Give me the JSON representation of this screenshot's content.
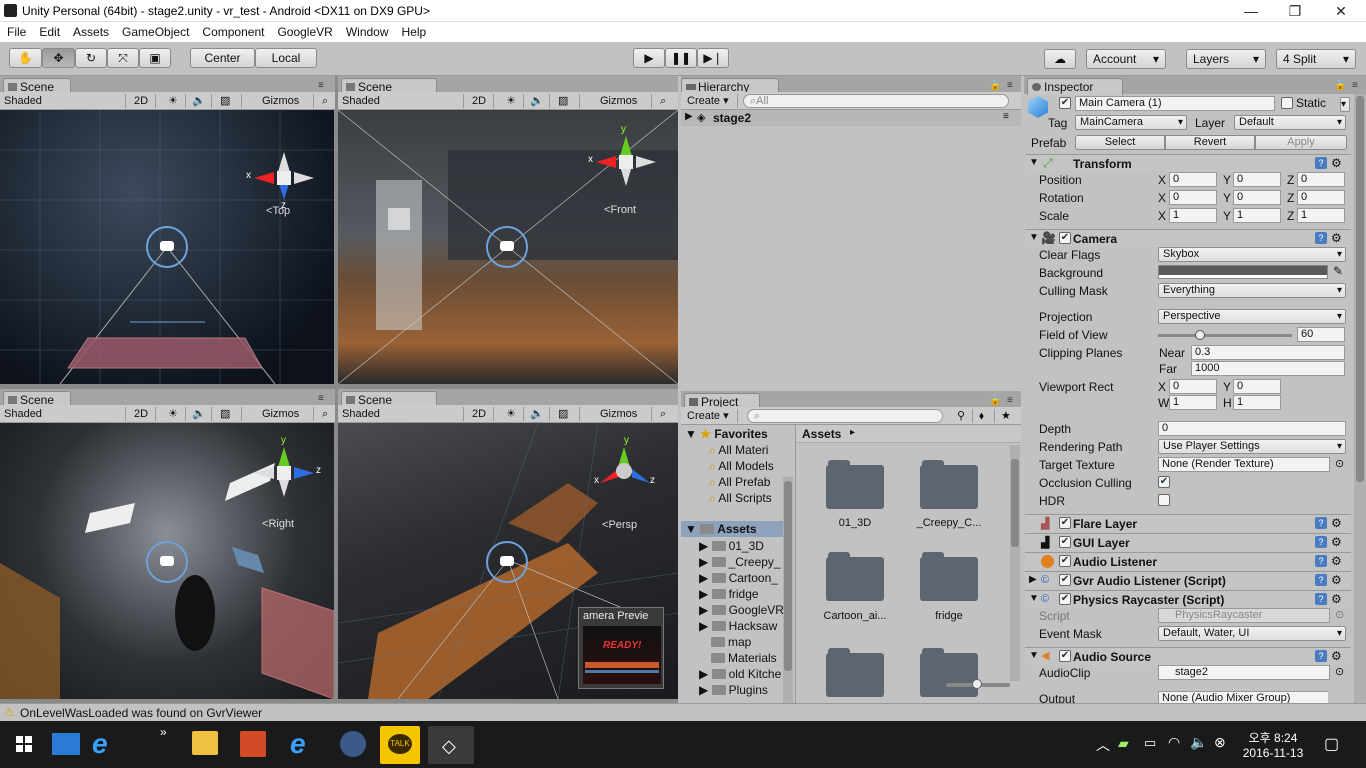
{
  "window": {
    "title": "Unity Personal (64bit) - stage2.unity - vr_test - Android <DX11 on DX9 GPU>",
    "minimize": "—",
    "maximize": "❐",
    "close": "✕"
  },
  "menu": [
    "File",
    "Edit",
    "Assets",
    "GameObject",
    "Component",
    "GoogleVR",
    "Window",
    "Help"
  ],
  "toolbar": {
    "center": "Center",
    "local": "Local",
    "account": "Account",
    "layers": "Layers",
    "layout": "4 Split"
  },
  "scene_views": [
    {
      "tab": "Scene",
      "shading": "Shaded",
      "mode2d": "2D",
      "gizmos": "Gizmos",
      "orient": "Top"
    },
    {
      "tab": "Scene",
      "shading": "Shaded",
      "mode2d": "2D",
      "gizmos": "Gizmos",
      "orient": "Front"
    },
    {
      "tab": "Scene",
      "shading": "Shaded",
      "mode2d": "2D",
      "gizmos": "Gizmos",
      "orient": "Right"
    },
    {
      "tab": "Scene",
      "shading": "Shaded",
      "mode2d": "2D",
      "gizmos": "Gizmos",
      "orient": "Persp",
      "preview": "amera Previe",
      "preview_text": "READY!"
    }
  ],
  "hierarchy": {
    "tab": "Hierarchy",
    "create": "Create",
    "search": "All",
    "root": "stage2"
  },
  "project": {
    "tab": "Project",
    "create": "Create",
    "favorites_label": "Favorites",
    "favorites": [
      "All Materi",
      "All Models",
      "All Prefab",
      "All Scripts"
    ],
    "assets_label": "Assets",
    "folders": [
      "01_3D",
      "_Creepy_",
      "Cartoon_",
      "fridge",
      "GoogleVR",
      "Hacksaw",
      "map",
      "Materials",
      "old Kitche",
      "Plugins"
    ],
    "breadcrumb": "Assets",
    "grid": [
      "01_3D",
      "_Creepy_C...",
      "Cartoon_ai...",
      "fridge"
    ]
  },
  "inspector": {
    "tab": "Inspector",
    "object_name": "Main Camera (1)",
    "static": "Static",
    "tag_label": "Tag",
    "tag": "MainCamera",
    "layer_label": "Layer",
    "layer": "Default",
    "prefab_label": "Prefab",
    "select": "Select",
    "revert": "Revert",
    "apply": "Apply",
    "transform": {
      "title": "Transform",
      "position": "Position",
      "rotation": "Rotation",
      "scale": "Scale",
      "pos": [
        "0",
        "0",
        "0"
      ],
      "rot": [
        "0",
        "0",
        "0"
      ],
      "scl": [
        "1",
        "1",
        "1"
      ]
    },
    "camera": {
      "title": "Camera",
      "clear_flags_label": "Clear Flags",
      "clear_flags": "Skybox",
      "background": "Background",
      "culling_label": "Culling Mask",
      "culling": "Everything",
      "projection_label": "Projection",
      "projection": "Perspective",
      "fov_label": "Field of View",
      "fov": "60",
      "clip_label": "Clipping Planes",
      "near_label": "Near",
      "near": "0.3",
      "far_label": "Far",
      "far": "1000",
      "viewport_label": "Viewport Rect",
      "vx": "0",
      "vy": "0",
      "vw": "1",
      "vh": "1",
      "depth_label": "Depth",
      "depth": "0",
      "render_label": "Rendering Path",
      "render": "Use Player Settings",
      "target_label": "Target Texture",
      "target": "None (Render Texture)",
      "occlusion": "Occlusion Culling",
      "hdr": "HDR",
      "fov_fraction": 0.3
    },
    "components": [
      "Flare Layer",
      "GUI Layer",
      "Audio Listener",
      "Gvr Audio Listener (Script)",
      "Physics Raycaster (Script)",
      "Audio Source"
    ],
    "raycaster": {
      "script_label": "Script",
      "script": "PhysicsRaycaster",
      "mask_label": "Event Mask",
      "mask": "Default, Water, UI"
    },
    "audio": {
      "clip_label": "AudioClip",
      "clip": "stage2",
      "output_label": "Output",
      "output": "None (Audio Mixer Group)"
    }
  },
  "status": "OnLevelWasLoaded was found on GvrViewer",
  "taskbar": {
    "time": "오후 8:24",
    "date": "2016-11-13"
  }
}
